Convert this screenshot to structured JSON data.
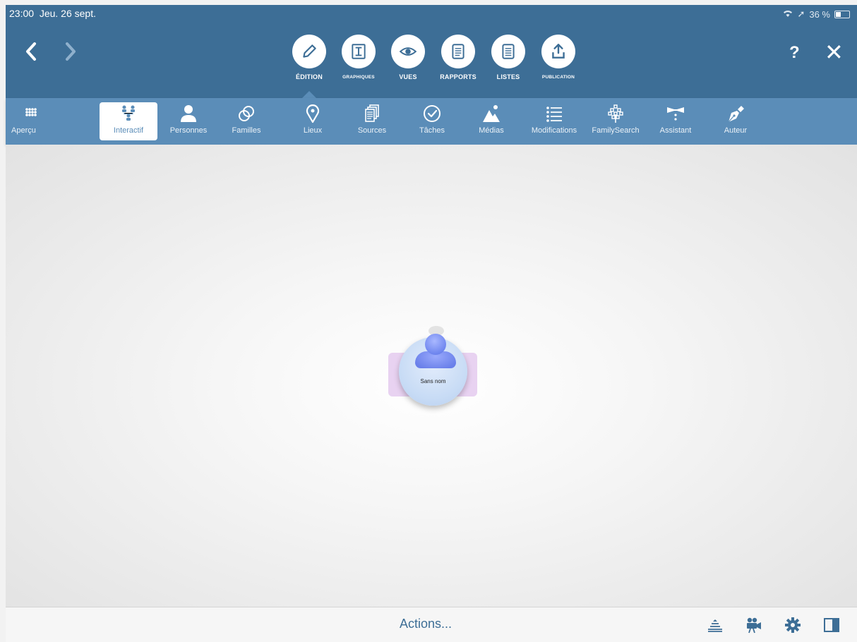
{
  "status": {
    "time": "23:00",
    "date": "Jeu. 26 sept.",
    "battery": "36 %"
  },
  "header": {
    "back_icon": "chevron-left-icon",
    "forward_icon": "chevron-right-icon",
    "help_label": "?",
    "close_label": "✕",
    "mode_tabs": [
      {
        "label": "ÉDITION",
        "icon": "pencil-icon",
        "active": true
      },
      {
        "label": "GRAPHIQUES",
        "icon": "chart-icon"
      },
      {
        "label": "VUES",
        "icon": "eye-icon"
      },
      {
        "label": "RAPPORTS",
        "icon": "report-icon"
      },
      {
        "label": "LISTES",
        "icon": "list-doc-icon"
      },
      {
        "label": "PUBLICATION",
        "icon": "upload-icon"
      }
    ]
  },
  "toolbar": {
    "items": [
      {
        "label": "Aperçu",
        "icon": "grid-icon"
      },
      {
        "label": "Interactif",
        "icon": "tree-icon",
        "active": true
      },
      {
        "label": "Personnes",
        "icon": "person-icon"
      },
      {
        "label": "Familles",
        "icon": "rings-icon"
      },
      {
        "label": "Lieux",
        "icon": "pin-icon"
      },
      {
        "label": "Sources",
        "icon": "documents-icon"
      },
      {
        "label": "Tâches",
        "icon": "check-circle-icon"
      },
      {
        "label": "Médias",
        "icon": "mountain-icon"
      },
      {
        "label": "Modifications",
        "icon": "list-icon"
      },
      {
        "label": "FamilySearch",
        "icon": "familysearch-icon"
      },
      {
        "label": "Assistant",
        "icon": "bowtie-icon"
      },
      {
        "label": "Auteur",
        "icon": "pen-nib-icon"
      }
    ]
  },
  "canvas": {
    "person_name": "Sans nom"
  },
  "bottom_bar": {
    "actions_label": "Actions...",
    "icons": [
      "layers-icon",
      "camera-icon",
      "gear-icon",
      "sidebar-icon"
    ]
  },
  "colors": {
    "header": "#3d6e96",
    "toolbar": "#5b8db8",
    "accent": "#3d6e96"
  }
}
